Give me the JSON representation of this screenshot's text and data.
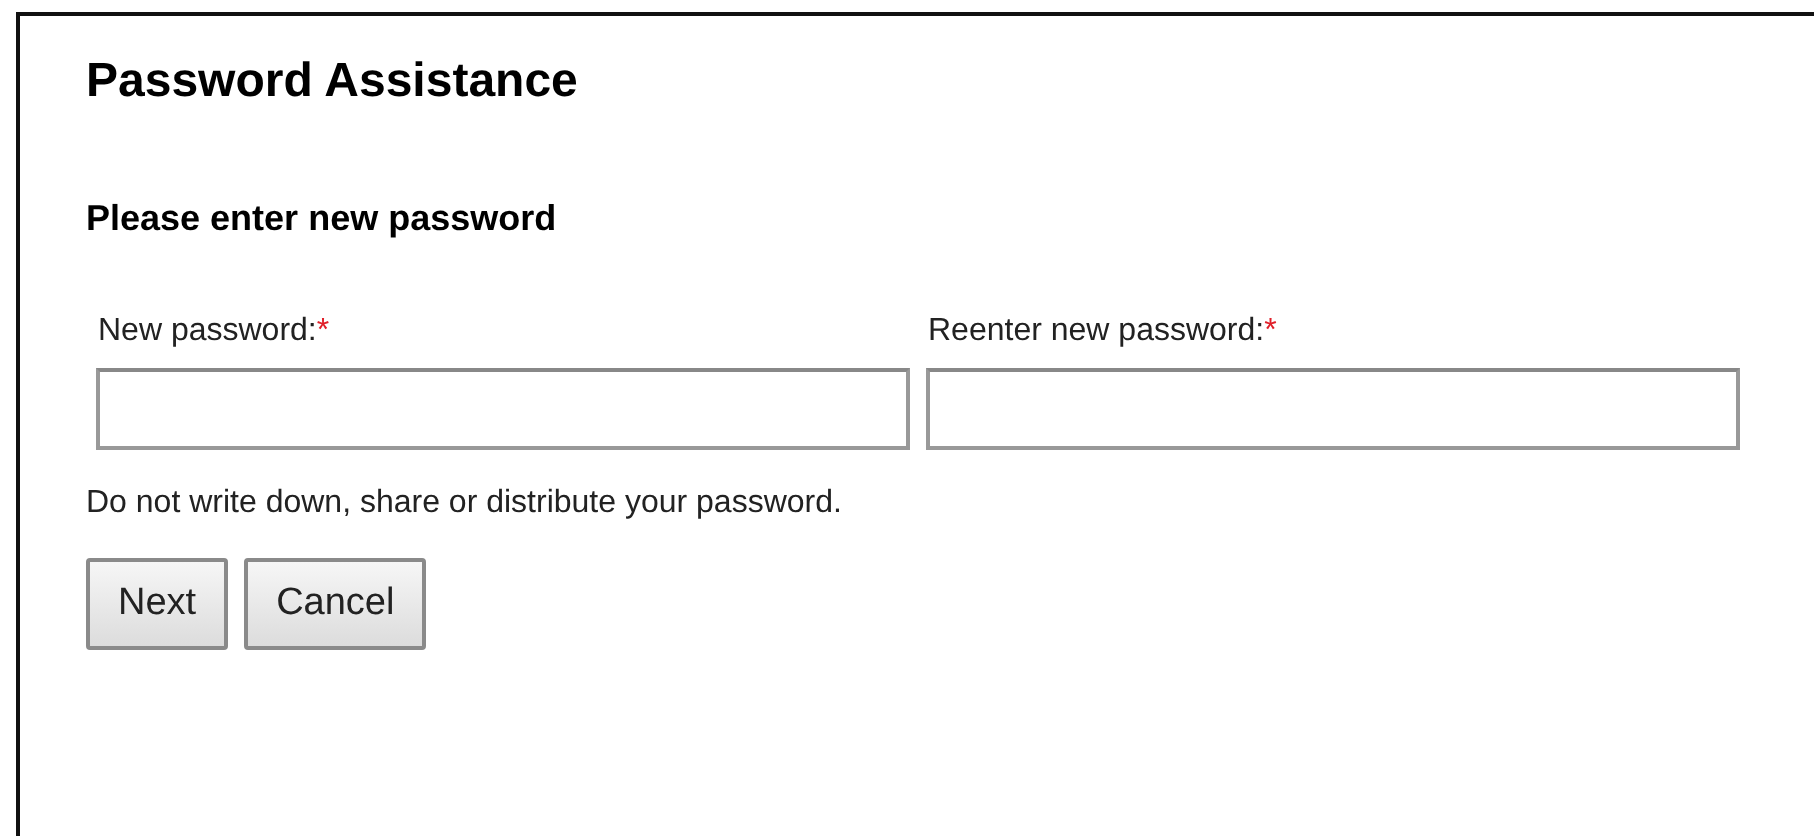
{
  "title": "Password Assistance",
  "subtitle": "Please enter new password",
  "fields": [
    {
      "label": "New password:",
      "required_mark": "*"
    },
    {
      "label": "Reenter new password:",
      "required_mark": "*"
    }
  ],
  "note": "Do not write down, share or distribute your password.",
  "buttons": [
    "Next",
    "Cancel"
  ]
}
